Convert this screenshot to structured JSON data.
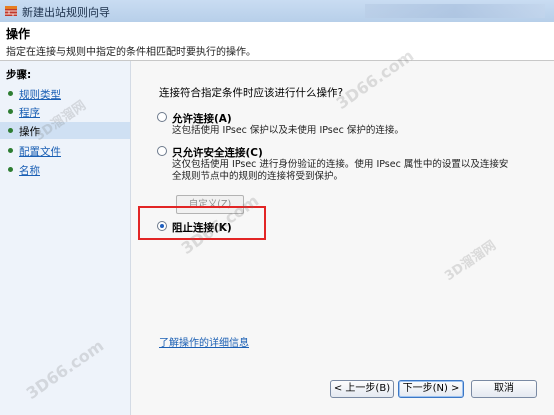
{
  "window": {
    "title": "新建出站规则向导"
  },
  "header": {
    "title": "操作",
    "subtitle": "指定在连接与规则中指定的条件相匹配时要执行的操作。"
  },
  "sidebar": {
    "steps_label": "步骤:",
    "items": [
      {
        "label": "规则类型",
        "state": "done"
      },
      {
        "label": "程序",
        "state": "done"
      },
      {
        "label": "操作",
        "state": "current"
      },
      {
        "label": "配置文件",
        "state": "done"
      },
      {
        "label": "名称",
        "state": "done"
      }
    ]
  },
  "main": {
    "question": "连接符合指定条件时应该进行什么操作?",
    "options": [
      {
        "title": "允许连接(A)",
        "desc_lines": [
          "这包括使用 IPsec 保护以及未使用 IPsec 保护的连接。"
        ],
        "selected": false
      },
      {
        "title": "只允许安全连接(C)",
        "desc_lines": [
          "这仅包括使用 IPsec 进行身份验证的连接。使用 IPsec 属性中的设置以及连接安",
          "全规则节点中的规则的连接将受到保护。"
        ],
        "selected": false
      },
      {
        "title": "阻止连接(K)",
        "desc_lines": [],
        "selected": true
      }
    ],
    "custom_button": "自定义(Z)",
    "learn_link": "了解操作的详细信息"
  },
  "footer": {
    "back": "< 上一步(B)",
    "next": "下一步(N) >",
    "cancel": "取消"
  },
  "colors": {
    "highlight": "#e22525",
    "link": "#1a5fb4",
    "step_bullet": "#2e7d32"
  },
  "watermarks": [
    "3D66.com",
    "3D溜溜网",
    "3D66.com",
    "3D溜溜网",
    "3D66.com"
  ]
}
